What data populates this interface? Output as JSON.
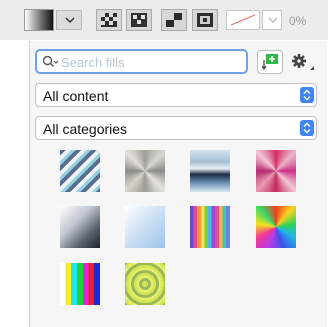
{
  "toolbar": {
    "opacity_label": "0%"
  },
  "panel": {
    "search": {
      "placeholder": "Search fills"
    },
    "content_select": {
      "value": "All content"
    },
    "category_select": {
      "value": "All categories"
    },
    "fills": [
      {
        "name": "diagonal-stripes-fill",
        "accent": "#5b6d8e"
      },
      {
        "name": "brushed-metal-conical-fill",
        "accent": "#b7b6b0"
      },
      {
        "name": "chrome-linear-fill",
        "accent": "#1c2e48"
      },
      {
        "name": "pink-radial-burst-fill",
        "accent": "#d62a64"
      },
      {
        "name": "dark-grey-diagonal-fill",
        "accent": "#5b6470"
      },
      {
        "name": "light-blue-diagonal-fill",
        "accent": "#9dc3eb"
      },
      {
        "name": "rainbow-stripes-fill",
        "accent": "#f09a35"
      },
      {
        "name": "rainbow-burst-fill",
        "accent": "#2fd356"
      },
      {
        "name": "tv-color-bars-fill",
        "accent": "#22e6e6"
      },
      {
        "name": "yellow-concentric-rings-fill",
        "accent": "#d5e854"
      }
    ]
  },
  "colors": {
    "focus_ring": "#6fa3e6",
    "stepper_blue": "#3f86f4",
    "new_fill_green": "#2fb84a"
  }
}
